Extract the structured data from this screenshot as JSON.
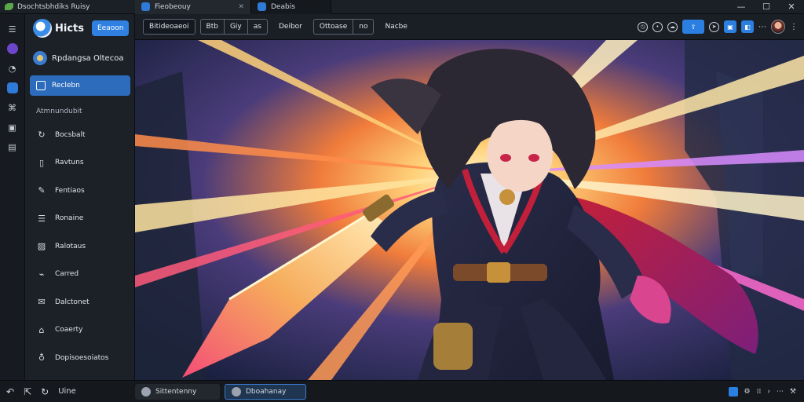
{
  "titlebar": {
    "app_title": "Dsochtsbhdiks Ruisy",
    "tabs": [
      {
        "label": "Fieobeouy"
      },
      {
        "label": "Deabis"
      }
    ],
    "window_controls": {
      "minimize": "—",
      "maximize": "☐",
      "close": "✕"
    }
  },
  "toolbar": {
    "btn1": "Bitideoaeoi",
    "btn2a": "Btb",
    "btn2b": "Giy",
    "btn2c": "as",
    "btn3": "Deibor",
    "btn4": "Ottoase",
    "btn4b": "no",
    "btn5": "Nacbe",
    "ellipsis": "⋯"
  },
  "sidebar": {
    "brand_name": "Hicts",
    "brand_button": "Eeaoon",
    "workspace": "Rpdangsa Oltecoa",
    "active_item": "Reclebn",
    "section_title": "Atmnundubit",
    "items": [
      {
        "label": "Bocsbalt",
        "icon": "refresh-icon"
      },
      {
        "label": "Ravtuns",
        "icon": "document-icon"
      },
      {
        "label": "Fentiaos",
        "icon": "pencil-icon"
      },
      {
        "label": "Ronaine",
        "icon": "list-icon"
      },
      {
        "label": "Ralotaus",
        "icon": "image-icon"
      },
      {
        "label": "Carred",
        "icon": "link-icon"
      },
      {
        "label": "Dalctonet",
        "icon": "mail-icon"
      },
      {
        "label": "Coaerty",
        "icon": "lock-icon"
      },
      {
        "label": "Dopisoesoiatos",
        "icon": "bag-icon"
      }
    ]
  },
  "bottombar": {
    "left_label": "Uine",
    "tab1": "Sittentenny",
    "tab2": "Dboahanay"
  },
  "colors": {
    "accent": "#2f80e0",
    "panel": "#1c2027",
    "background": "#0f1217"
  }
}
